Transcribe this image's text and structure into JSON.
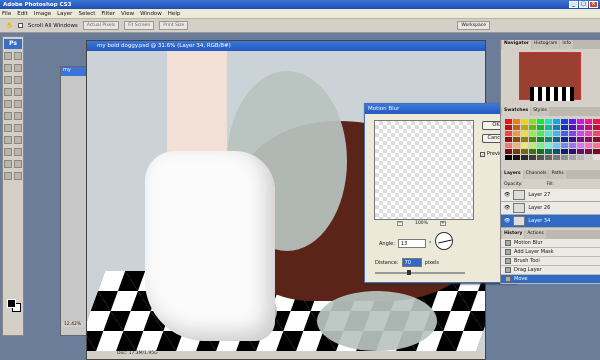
{
  "app_title": "Adobe Photoshop CS3",
  "menu": [
    "File",
    "Edit",
    "Image",
    "Layer",
    "Select",
    "Filter",
    "View",
    "Window",
    "Help"
  ],
  "options_bar": {
    "scroll_all": "Scroll All Windows",
    "actual_pixels": "Actual Pixels",
    "fit_screen": "Fit Screen",
    "print_size": "Print Size",
    "workspace": "Workspace"
  },
  "document": {
    "title": "my bold doggy.psd @ 31.6% (Layer 34, RGB/8#)",
    "status": "Doc: 17.3M/1.95G",
    "second_zoom": "12.42%"
  },
  "motion_blur": {
    "title": "Motion Blur",
    "ok": "OK",
    "cancel": "Cancel",
    "preview_label": "Preview",
    "preview_checked": true,
    "zoom": "100%",
    "angle_label": "Angle:",
    "angle_value": "13",
    "angle_unit": "°",
    "distance_label": "Distance:",
    "distance_value": "70",
    "distance_unit": "pixels"
  },
  "panels": {
    "nav_tabs": [
      "Navigator",
      "Histogram",
      "Info"
    ],
    "swatch_tabs": [
      "Swatches",
      "Styles"
    ],
    "layer_tabs": [
      "Layers",
      "Channels",
      "Paths"
    ],
    "opacity_label": "Opacity:",
    "fill_label": "Fill:",
    "layers": [
      {
        "name": "Layer 27",
        "selected": false
      },
      {
        "name": "Layer 26",
        "selected": false
      },
      {
        "name": "Layer 34",
        "selected": true
      }
    ],
    "history_tabs": [
      "History",
      "Actions"
    ],
    "history": [
      {
        "name": "Motion Blur",
        "selected": false
      },
      {
        "name": "Add Layer Mask",
        "selected": false
      },
      {
        "name": "Brush Tool",
        "selected": false
      },
      {
        "name": "Drag Layer",
        "selected": false
      },
      {
        "name": "Move",
        "selected": true
      }
    ]
  },
  "colors": {
    "titlebar": "#2458c0",
    "selection": "#316ac5",
    "dog": "#5a2518"
  }
}
